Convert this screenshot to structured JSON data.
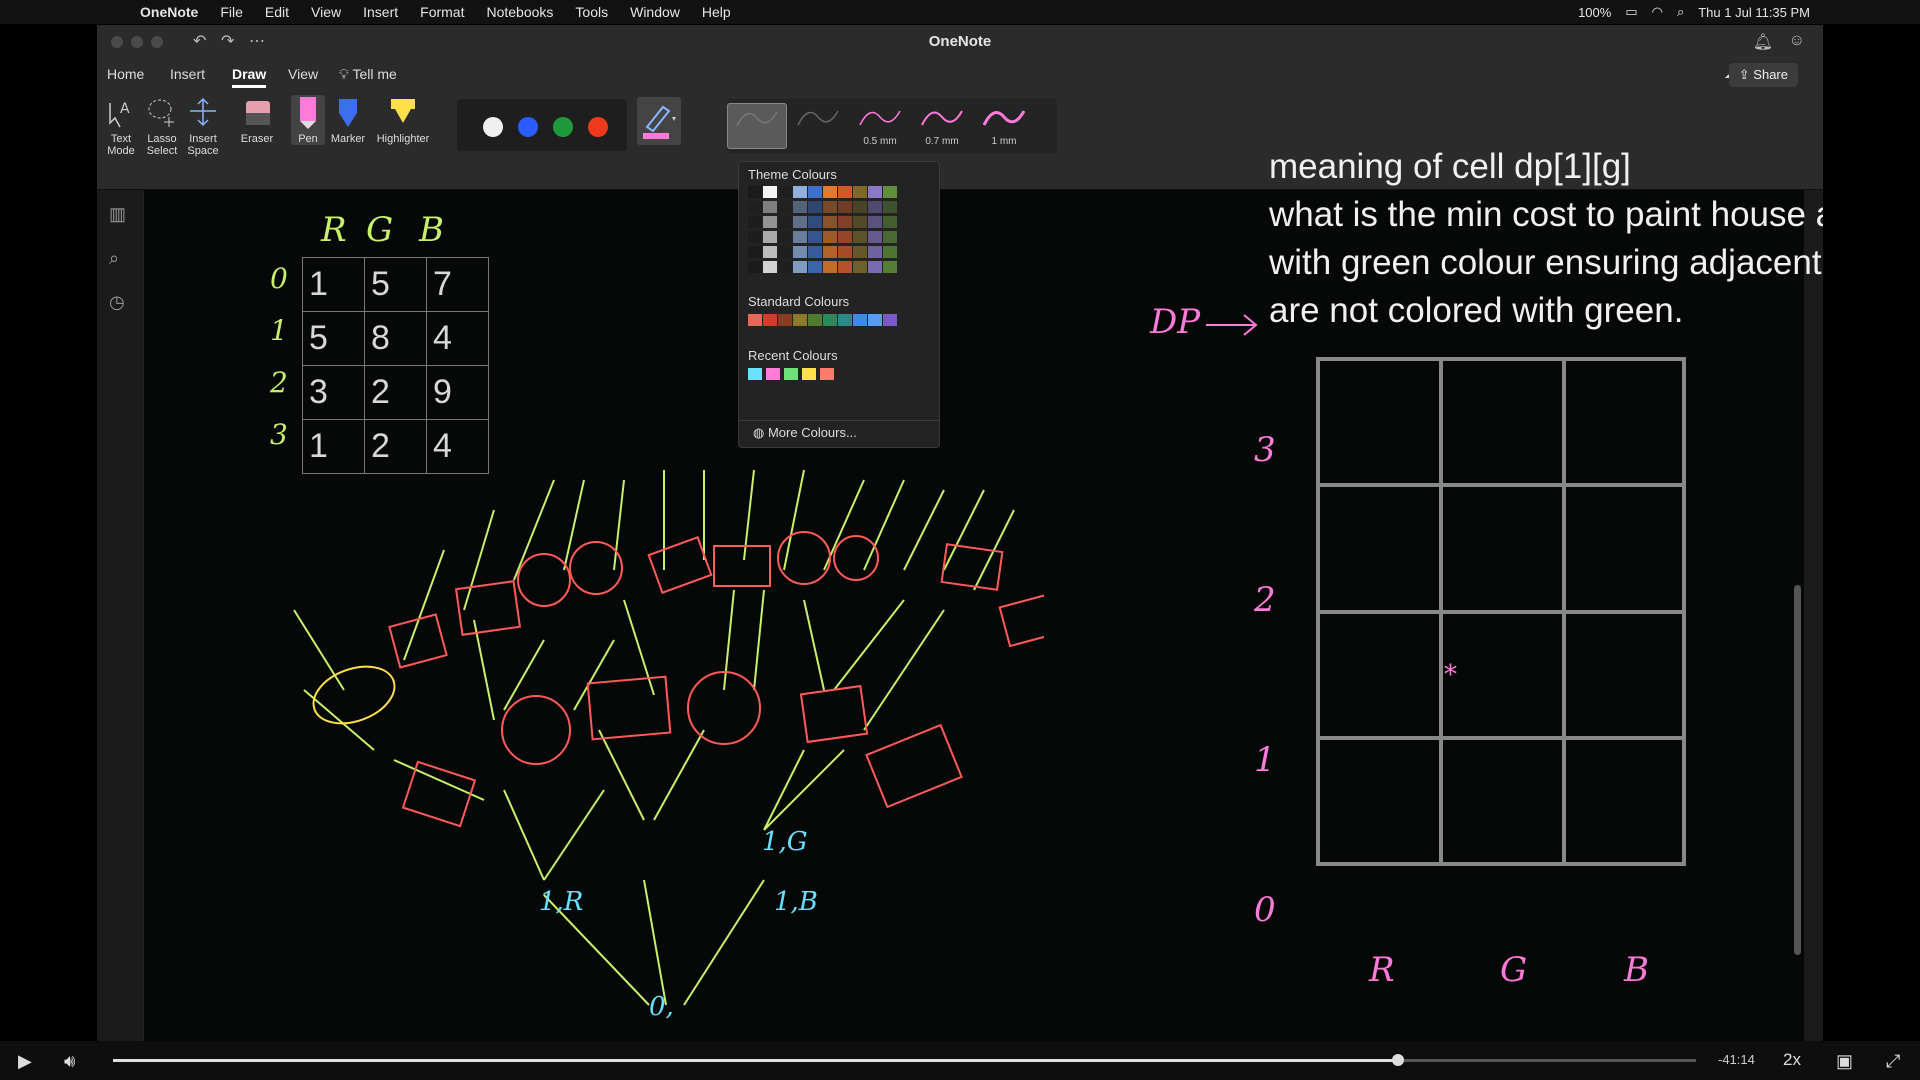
{
  "menubar": {
    "app": "OneNote",
    "items": [
      "File",
      "Edit",
      "View",
      "Insert",
      "Format",
      "Notebooks",
      "Tools",
      "Window",
      "Help"
    ],
    "battery": "100%",
    "datetime": "Thu 1 Jul  11:35 PM"
  },
  "window": {
    "title": "OneNote"
  },
  "ribbon": {
    "tabs": [
      "Home",
      "Insert",
      "Draw",
      "View",
      "Tell me"
    ],
    "share": "Share",
    "tools": {
      "text_mode": "Text Mode",
      "lasso": "Lasso Select",
      "insert_space": "Insert Space",
      "eraser": "Eraser",
      "pen": "Pen",
      "marker": "Marker",
      "highlighter": "Highlighter"
    },
    "pen_sizes": [
      "",
      "",
      "0.5 mm",
      "0.7 mm",
      "1 mm"
    ]
  },
  "colour_popup": {
    "theme_title": "Theme Colours",
    "standard_title": "Standard Colours",
    "recent_title": "Recent Colours",
    "more": "More Colours..."
  },
  "colors": {
    "accent_pink": "#ff7ad9",
    "yellowgreen": "#c8f06a",
    "red_ink": "#ff5a5a",
    "cyan_ink": "#6ae0ff"
  },
  "note": {
    "line1": "meaning of cell dp[1][g]",
    "line2": "what is the min cost to paint house at index i ,",
    "line3": "with green colour ensuring adjacent house",
    "line4": "are not colored with green."
  },
  "cost_table": {
    "headers": [
      "R",
      "G",
      "B"
    ],
    "row_labels": [
      "0",
      "1",
      "2",
      "3"
    ],
    "rows": [
      [
        "1",
        "5",
        "7"
      ],
      [
        "5",
        "8",
        "4"
      ],
      [
        "3",
        "2",
        "9"
      ],
      [
        "1",
        "2",
        "4"
      ]
    ]
  },
  "dp_grid": {
    "label": "DP",
    "row_labels": [
      "3",
      "2",
      "1",
      "0"
    ],
    "col_labels": [
      "R",
      "G",
      "B"
    ],
    "mark": "*"
  },
  "player": {
    "remaining": "-41:14",
    "rate": "2x"
  }
}
